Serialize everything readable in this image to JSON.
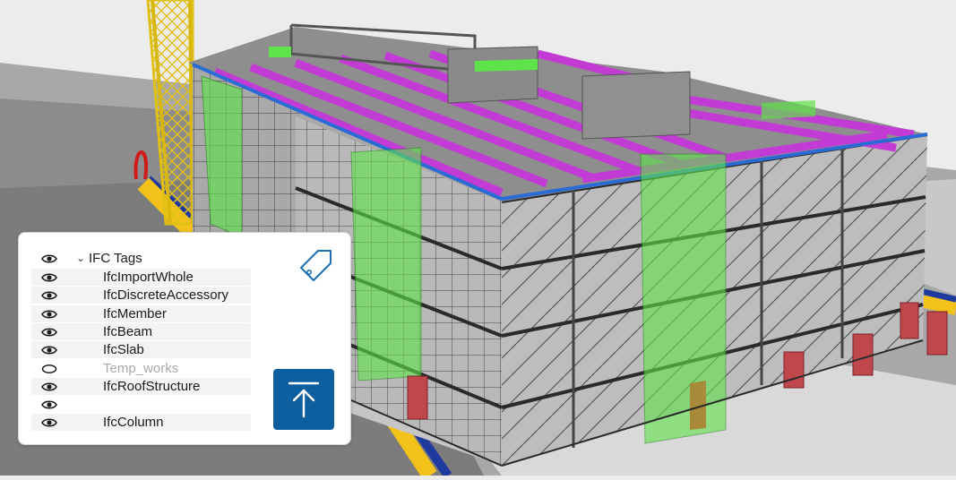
{
  "panel": {
    "title": "IFC Tags",
    "title_visible": true,
    "items": [
      {
        "label": "IfcImportWhole",
        "visible": true
      },
      {
        "label": "IfcDiscreteAccessory",
        "visible": true
      },
      {
        "label": "IfcMember",
        "visible": true
      },
      {
        "label": "IfcBeam",
        "visible": true
      },
      {
        "label": "IfcSlab",
        "visible": true
      },
      {
        "label": "Temp_works",
        "visible": false
      },
      {
        "label": "IfcRoofStructure",
        "visible": true
      },
      {
        "label": "",
        "visible": true
      },
      {
        "label": "IfcColumn",
        "visible": true
      }
    ],
    "tag_icon": "tag-icon",
    "upload_icon": "upload-icon"
  },
  "colors": {
    "accent": "#0e5fa0",
    "tag_icon": "#1c6fb3",
    "slab_members": "#c23bd4",
    "stair_cores": "#5fe34a",
    "scaffold": "#2a2a2a",
    "ground_stripe": "#f2c21b",
    "crane": "#f2d21b",
    "formwork": "#c0484d"
  }
}
